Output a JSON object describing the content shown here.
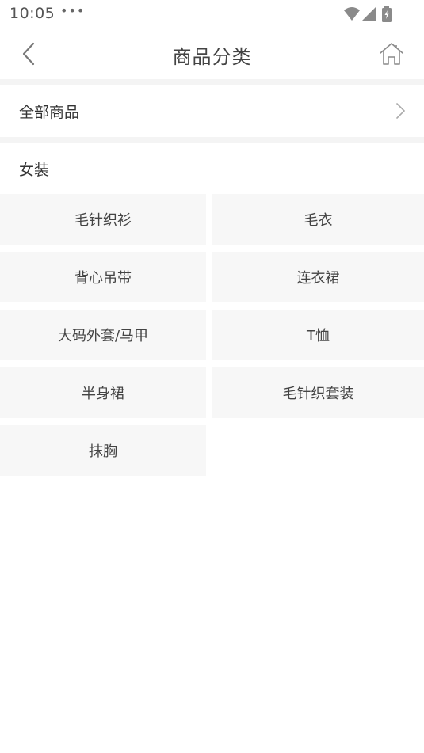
{
  "status_bar": {
    "time": "10:05",
    "more": "•••"
  },
  "header": {
    "title": "商品分类",
    "back_icon": "chevron-left-icon",
    "home_icon": "home-icon"
  },
  "all_products": {
    "label": "全部商品",
    "chevron_icon": "chevron-right-icon"
  },
  "section": {
    "title": "女装",
    "categories": [
      "毛针织衫",
      "毛衣",
      "背心吊带",
      "连衣裙",
      "大码外套/马甲",
      "T恤",
      "半身裙",
      "毛针织套装",
      "抹胸"
    ]
  },
  "colors": {
    "background": "#ffffff",
    "cell_background": "#f7f7f7",
    "divider": "#f4f4f4",
    "text": "#333333"
  }
}
